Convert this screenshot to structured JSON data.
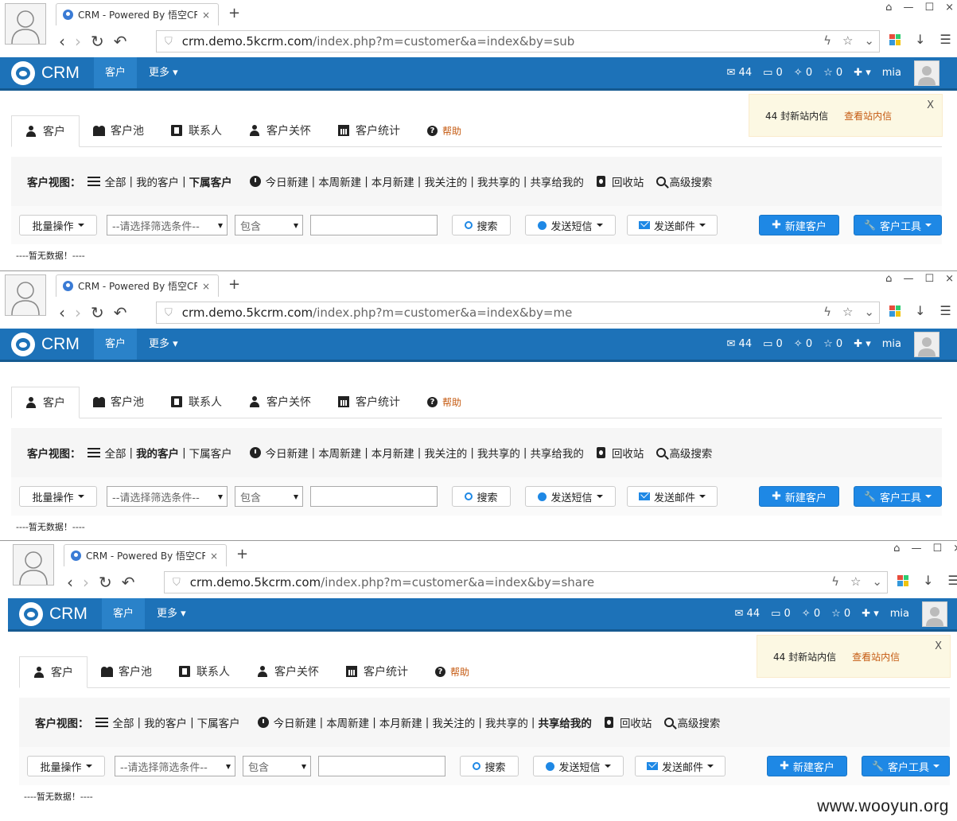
{
  "browser": {
    "tab_title": "CRM - Powered By 悟空CR",
    "tab_close": "×",
    "new_tab": "+",
    "window_controls": [
      "⌂",
      "—",
      "☐",
      "×"
    ],
    "url_host": "crm.demo.5kcrm.com",
    "url_paths": [
      "/index.php?m=customer&a=index&by=sub",
      "/index.php?m=customer&a=index&by=me",
      "/index.php?m=customer&a=index&by=share"
    ]
  },
  "navbar": {
    "logo_text": "CRM",
    "active_item": "客户",
    "more_item": "更多",
    "mail_count": "44",
    "count2": "0",
    "count3": "0",
    "count4": "0",
    "user": "mia"
  },
  "tabs": {
    "customer": "客户",
    "pool": "客户池",
    "contacts": "联系人",
    "care": "客户关怀",
    "stats": "客户统计",
    "help": "帮助"
  },
  "view": {
    "label": "客户视图：",
    "all": "全部",
    "mine": "我的客户",
    "sub": "下属客户",
    "today": "今日新建",
    "week": "本周新建",
    "month": "本月新建",
    "followed": "我关注的",
    "shared": "我共享的",
    "shared_to_me": "共享给我的",
    "recycle": "回收站",
    "advanced": "高级搜索",
    "sep": "|"
  },
  "toolbar": {
    "batch": "批量操作",
    "filter_placeholder": "--请选择筛选条件--",
    "contains": "包含",
    "search": "搜索",
    "sms": "发送短信",
    "email": "发送邮件",
    "new_customer": "新建客户",
    "customer_tools": "客户工具"
  },
  "empty_text": "----暂无数据！----",
  "notification": {
    "text": "44 封新站内信",
    "link": "查看站内信",
    "close": "X"
  },
  "watermark": "www.wooyun.org",
  "colors": {
    "navbar": "#1d72b8",
    "button_blue": "#1e88e5",
    "help_orange": "#c55a11"
  }
}
